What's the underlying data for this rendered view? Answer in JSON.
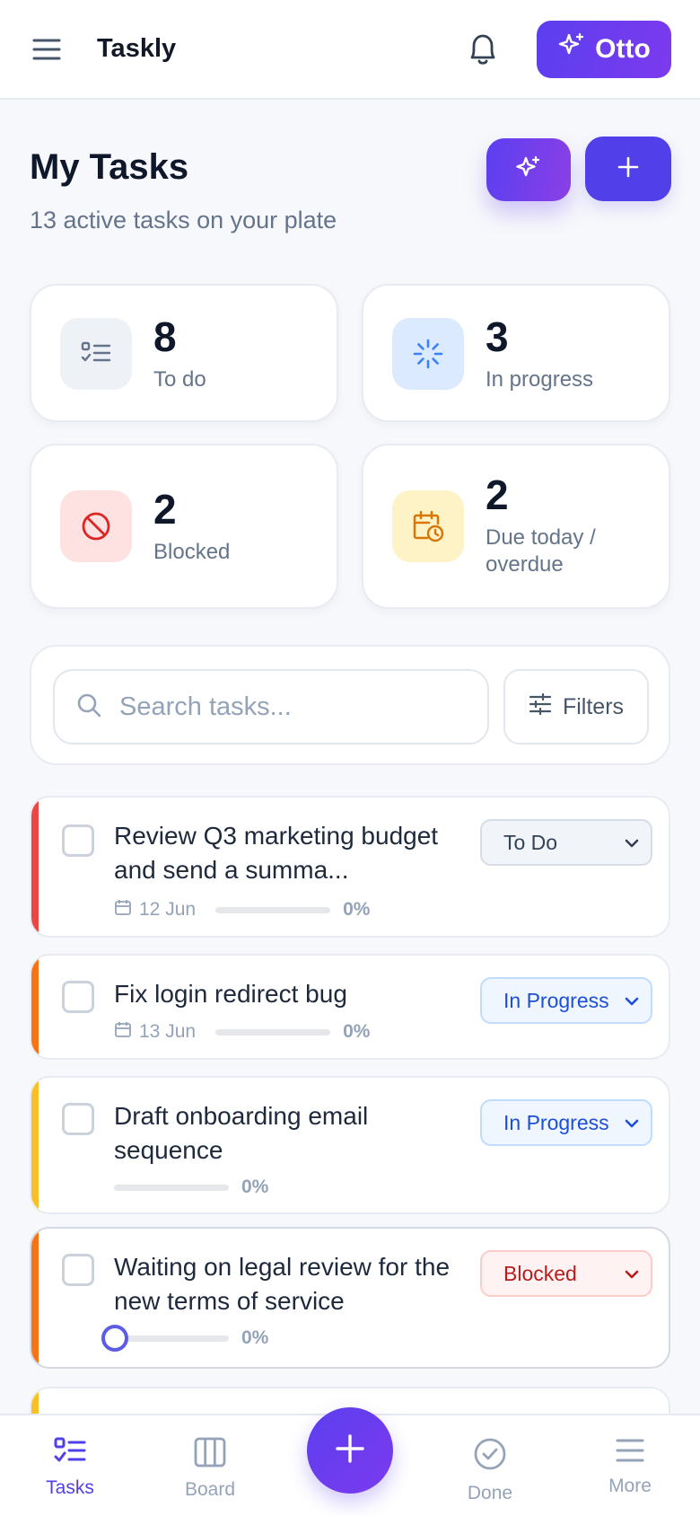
{
  "header": {
    "app_title": "Taskly",
    "assistant_label": "Otto"
  },
  "page": {
    "title": "My Tasks",
    "subtitle": "13 active tasks on your plate"
  },
  "stats": [
    {
      "count": "8",
      "label": "To do",
      "icon": "checklist-icon",
      "color": "#64748b"
    },
    {
      "count": "3",
      "label": "In progress",
      "icon": "loader-icon",
      "color": "#3b82f6"
    },
    {
      "count": "2",
      "label": "Blocked",
      "icon": "ban-icon",
      "color": "#dc2626"
    },
    {
      "count": "2",
      "label": "Due today / overdue",
      "icon": "calendar-clock-icon",
      "color": "#d97706"
    }
  ],
  "search": {
    "placeholder": "Search tasks...",
    "filters_label": "Filters"
  },
  "tasks": [
    {
      "title": "Review Q3 marketing budget and send a summa...",
      "date": "12 Jun",
      "progress": "0%",
      "status": "To Do",
      "accent": "#ef4444"
    },
    {
      "title": "Fix login redirect bug",
      "date": "13 Jun",
      "progress": "0%",
      "status": "In Progress",
      "accent": "#f97316"
    },
    {
      "title": "Draft onboarding email sequence",
      "date": "",
      "progress": "0%",
      "status": "In Progress",
      "accent": "#fbbf24"
    },
    {
      "title": "Waiting on legal review for the new terms of service",
      "date": "",
      "progress": "0%",
      "status": "Blocked",
      "accent": "#f97316"
    }
  ],
  "nav": {
    "tasks": "Tasks",
    "board": "Board",
    "done": "Done",
    "more": "More"
  },
  "colors": {
    "primary": "#5140ea",
    "accent_purple": "#7c3aed"
  }
}
